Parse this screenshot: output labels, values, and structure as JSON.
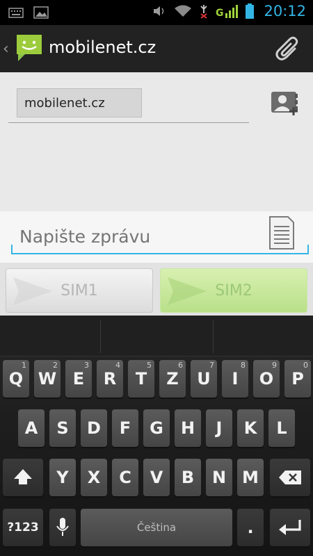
{
  "status_bar": {
    "time": "20:12",
    "network_type": "G"
  },
  "action_bar": {
    "title": "mobilenet.cz"
  },
  "recipient": {
    "chip_text": "mobilenet.cz"
  },
  "message": {
    "placeholder": "Napište zprávu"
  },
  "sim_buttons": [
    {
      "label": "SIM1"
    },
    {
      "label": "SIM2"
    }
  ],
  "keyboard": {
    "row1": [
      {
        "label": "Q",
        "hint": "1"
      },
      {
        "label": "W",
        "hint": "2"
      },
      {
        "label": "E",
        "hint": "3"
      },
      {
        "label": "R",
        "hint": "4"
      },
      {
        "label": "T",
        "hint": "5"
      },
      {
        "label": "Z",
        "hint": "6"
      },
      {
        "label": "U",
        "hint": "7"
      },
      {
        "label": "I",
        "hint": "8"
      },
      {
        "label": "O",
        "hint": "9"
      },
      {
        "label": "P",
        "hint": "0"
      }
    ],
    "row2": [
      "A",
      "S",
      "D",
      "F",
      "G",
      "H",
      "J",
      "K",
      "L"
    ],
    "row3": [
      "Y",
      "X",
      "C",
      "V",
      "B",
      "N",
      "M"
    ],
    "symbols_label": "?123",
    "space_label": "Čeština",
    "period_label": "."
  },
  "colors": {
    "accent": "#33b5e5",
    "sim2_green": "#b9e08a"
  }
}
